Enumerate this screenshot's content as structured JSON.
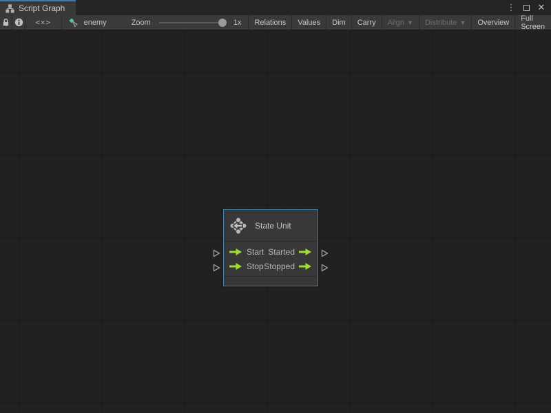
{
  "tab_bar": {
    "tab_title": "Script Graph",
    "menu_glyph": "⋮",
    "close_glyph": "✕"
  },
  "toolbar": {
    "code_glyph": "<×>",
    "graph_name": "enemy",
    "zoom_label": "Zoom",
    "zoom_value": "1x",
    "caret_glyph": "▼",
    "buttons": {
      "relations": "Relations",
      "values": "Values",
      "dim": "Dim",
      "carry": "Carry",
      "align": "Align",
      "distribute": "Distribute",
      "overview": "Overview",
      "fullscreen": "Full Screen"
    }
  },
  "graph": {
    "node": {
      "title": "State Unit",
      "rows": [
        {
          "input": "Start",
          "output": "Started"
        },
        {
          "input": "Stop",
          "output": "Stopped"
        }
      ]
    }
  },
  "colors": {
    "accent_blue": "#3a79bb",
    "selection_border": "#4180a6",
    "flow_green": "#9fdd35",
    "canvas_bg": "#212121"
  }
}
